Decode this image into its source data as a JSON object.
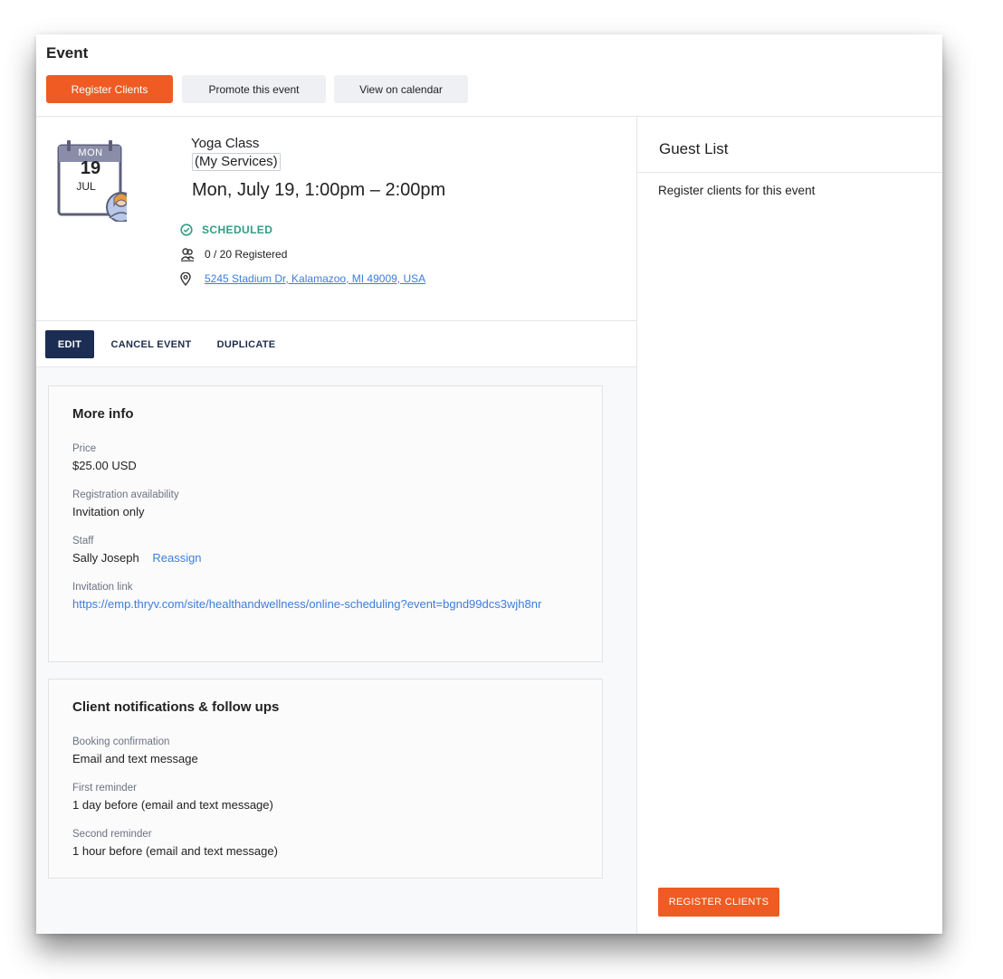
{
  "header": {
    "title": "Event",
    "register_clients_label": "Register Clients",
    "promote_label": "Promote this event",
    "view_calendar_label": "View on calendar"
  },
  "event": {
    "calendar_day_of_week": "MON",
    "calendar_day": "19",
    "calendar_month": "JUL",
    "name": "Yoga Class",
    "category": "(My Services)",
    "datetime": "Mon, July 19, 1:00pm – 2:00pm",
    "status": "SCHEDULED",
    "registered": "0 / 20 Registered",
    "address": "5245 Stadium Dr, Kalamazoo, MI 49009, USA"
  },
  "actions": {
    "edit": "EDIT",
    "cancel": "CANCEL EVENT",
    "duplicate": "DUPLICATE"
  },
  "more_info": {
    "title": "More info",
    "price_label": "Price",
    "price_value": "$25.00 USD",
    "availability_label": "Registration availability",
    "availability_value": "Invitation only",
    "staff_label": "Staff",
    "staff_value": "Sally Joseph",
    "reassign_label": "Reassign",
    "invitation_label": "Invitation link",
    "invitation_link": "https://emp.thryv.com/site/healthandwellness/online-scheduling?event=bgnd99dcs3wjh8nr"
  },
  "notifications": {
    "title": "Client notifications & follow ups",
    "booking_label": "Booking confirmation",
    "booking_value": "Email and text message",
    "first_label": "First reminder",
    "first_value": "1 day before (email and text message)",
    "second_label": "Second reminder",
    "second_value": "1 hour before (email and text message)"
  },
  "guest_list": {
    "title": "Guest List",
    "description": "Register clients for this event",
    "button_label": "REGISTER CLIENTS"
  },
  "colors": {
    "primary": "#ef5b23",
    "navy": "#1b2d52",
    "status_green": "#2e9f83",
    "link_blue": "#3b7ddd"
  },
  "icons": {
    "calendar": "calendar-with-avatar-icon",
    "status": "check-circle-icon",
    "registered": "people-icon",
    "location": "map-pin-icon"
  }
}
